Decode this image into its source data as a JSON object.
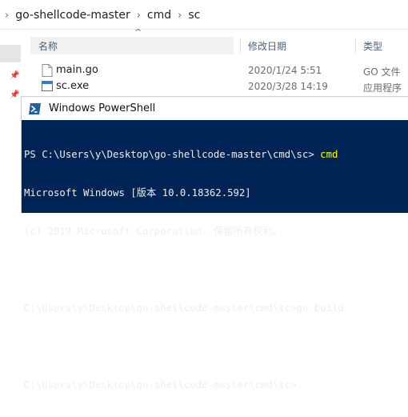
{
  "explorer": {
    "breadcrumb": [
      "go-shellcode-master",
      "cmd",
      "sc"
    ],
    "columns": {
      "name": "名称",
      "date": "修改日期",
      "type": "类型"
    },
    "files": [
      {
        "name": "main.go",
        "date": "2020/1/24 5:51",
        "type": "GO 文件",
        "icon": "go-file-icon"
      },
      {
        "name": "sc.exe",
        "date": "2020/3/28 14:19",
        "type": "应用程序",
        "icon": "exe-file-icon"
      }
    ]
  },
  "powershell": {
    "title": "Windows PowerShell",
    "lines": [
      {
        "prompt": "PS C:\\Users\\y\\Desktop\\go-shellcode-master\\cmd\\sc> ",
        "command": "cmd"
      },
      {
        "text": "Microsoft Windows [版本 10.0.18362.592]"
      },
      {
        "text": "(c) 2019 Microsoft Corporation. 保留所有权利。"
      },
      {
        "text": ""
      },
      {
        "text": "C:\\Users\\y\\Desktop\\go-shellcode-master\\cmd\\sc>go build"
      },
      {
        "text": ""
      },
      {
        "text": "C:\\Users\\y\\Desktop\\go-shellcode-master\\cmd\\sc>"
      }
    ],
    "colors": {
      "background": "#012456",
      "text": "#eeedf0",
      "command": "#ffff00"
    }
  }
}
